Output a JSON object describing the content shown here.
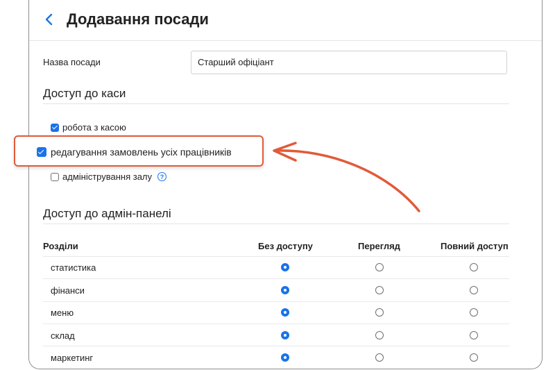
{
  "header": {
    "title": "Додавання посади"
  },
  "name_field": {
    "label": "Назва посади",
    "value": "Старший офіціант"
  },
  "cash_access": {
    "title": "Доступ до каси",
    "options": [
      {
        "label": "робота з касою",
        "checked": true
      },
      {
        "label": "редагування замовлень усіх працівників",
        "checked": true
      },
      {
        "label": "адміністрування залу",
        "checked": false
      }
    ]
  },
  "admin_access": {
    "title": "Доступ до адмін-панелі",
    "columns": [
      "Розділи",
      "Без доступу",
      "Перегляд",
      "Повний доступ"
    ],
    "rows": [
      {
        "label": "статистика",
        "selected": "Без доступу"
      },
      {
        "label": "фінанси",
        "selected": "Без доступу"
      },
      {
        "label": "меню",
        "selected": "Без доступу"
      },
      {
        "label": "склад",
        "selected": "Без доступу"
      },
      {
        "label": "маркетинг",
        "selected": "Без доступу"
      }
    ]
  },
  "colors": {
    "accent": "#1a73e8",
    "highlight": "#e15a39"
  },
  "icons": {
    "back": "chevron-left-icon",
    "help": "question-circle-icon"
  }
}
